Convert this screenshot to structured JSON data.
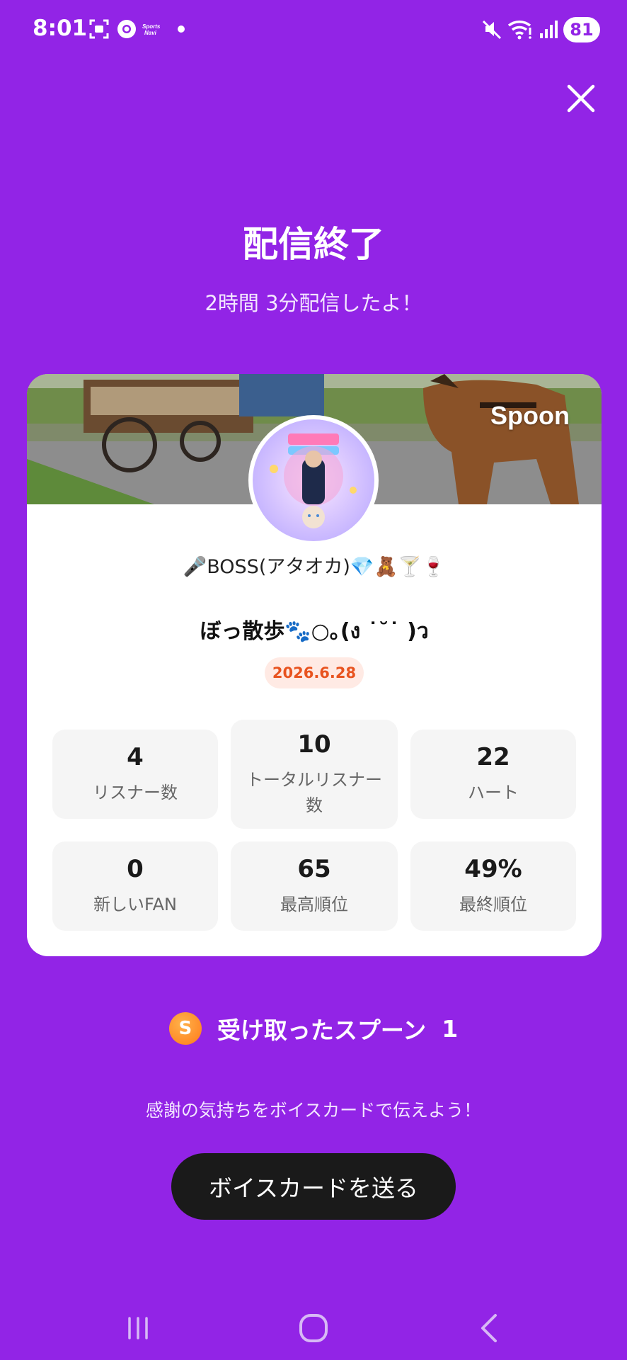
{
  "status_bar": {
    "time": "8:01",
    "notification_icons": [
      "screenshot-icon",
      "chrome-icon",
      "app-icon",
      "dot-icon"
    ],
    "app_icon_text": "Sports Navi",
    "system_icons": [
      "mute-icon",
      "wifi-icon",
      "signal-icon"
    ],
    "battery": "81"
  },
  "header": {
    "title": "配信終了",
    "subtitle": "2時間 3分配信したよ！"
  },
  "card": {
    "brand": "Spoon",
    "dj_name": "🎤BOSS(アタオカ)💎🧸🍸🍷",
    "live_title": "ぼっ散歩🐾○｡(ง ˙˘˙ )ว",
    "date": "2026.6.28",
    "stats": [
      {
        "value": "4",
        "label": "リスナー数"
      },
      {
        "value": "10",
        "label": "トータルリスナー数"
      },
      {
        "value": "22",
        "label": "ハート"
      },
      {
        "value": "0",
        "label": "新しいFAN"
      },
      {
        "value": "65",
        "label": "最高順位"
      },
      {
        "value": "49%",
        "label": "最終順位"
      }
    ]
  },
  "spoons": {
    "coin_letter": "S",
    "label": "受け取ったスプーン",
    "count": "1"
  },
  "thanks_text": "感謝の気持ちをボイスカードで伝えよう！",
  "voice_card_button": "ボイスカードを送る",
  "colors": {
    "background": "#9224E6",
    "button": "#1A1A1A",
    "date_badge_bg": "#FFEAE4",
    "date_badge_text": "#E8531F",
    "spoon_coin": "#FF8A1F"
  }
}
